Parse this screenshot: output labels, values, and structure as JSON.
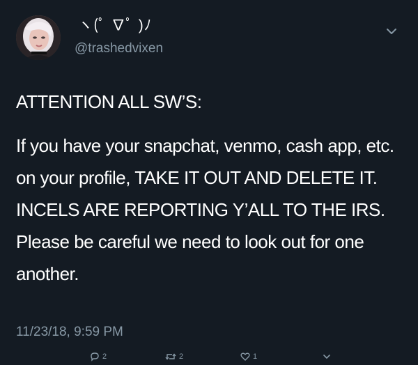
{
  "user": {
    "display_name": "ヽ(ﾟ ∇ﾟ )ﾉ",
    "handle": "@trashedvixen"
  },
  "tweet": {
    "heading": "ATTENTION ALL SW’S:",
    "body": "If you have your snapchat, venmo, cash app, etc. on your profile, TAKE IT OUT AND DELETE IT. INCELS ARE REPORTING Y’ALL TO THE IRS. Please be careful we need to look out for one another.",
    "timestamp": "11/23/18, 9:59 PM"
  },
  "actions": {
    "reply_count": "2",
    "retweet_count": "2",
    "like_count": "1"
  },
  "icons": {
    "menu": "chevron-down-icon",
    "reply": "reply-icon",
    "retweet": "retweet-icon",
    "like": "heart-icon",
    "share": "share-icon"
  }
}
